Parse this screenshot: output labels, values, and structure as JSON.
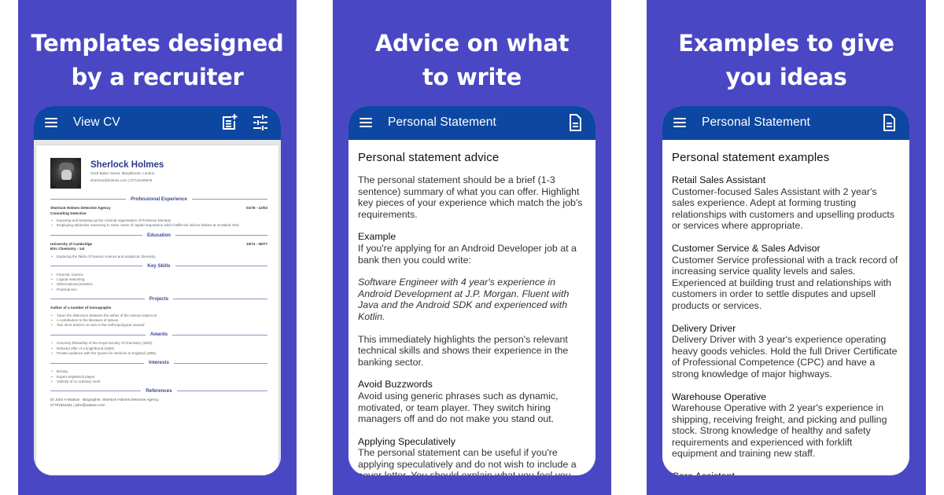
{
  "colors": {
    "panel_background": "#4a47c4",
    "app_bar": "#0d47a1",
    "heading_text": "#ffffff",
    "cv_name": "#283a8a"
  },
  "panels": [
    {
      "heading_line1": "Templates designed",
      "heading_line2": "by a recruiter",
      "app_bar": {
        "menu_icon": "hamburger-menu-icon",
        "title": "View CV",
        "actions": [
          "add-note-icon",
          "tune-settings-icon"
        ]
      },
      "cv": {
        "name": "Sherlock Holmes",
        "address": "221b Baker Street, Marylebone, London",
        "contact": "sherlock@holmes.com | 07712345678",
        "sections": {
          "experience": {
            "title": "Professional Experience",
            "employer": "Sherlock Holmes Detective Agency",
            "dates": "01/78 - 12/03",
            "role": "Consulting Detective",
            "bullets": [
              "Exposing and breaking up the criminal organisation of Professor Moriarty",
              "Employing abductive reasoning to solve cases of capital importance which baffle the inferior fellows at Scotland Yard"
            ]
          },
          "education": {
            "title": "Education",
            "institution": "University of Cambridge",
            "dates": "10/74 - 06/77",
            "degree": "BSc Chemistry - 1st",
            "bullets": [
              "Exploring the fields of forensic science and analytical chemistry"
            ]
          },
          "skills": {
            "title": "Key Skills",
            "bullets": [
              "Forensic science",
              "Logical reasoning",
              "Observational prowess",
              "Practical kno"
            ]
          },
          "projects": {
            "title": "Projects",
            "heading": "Author of a number of monographs",
            "bullets": [
              "'Upon the distinction between the ashes of the various tobaccos'",
              "A contribution to the literature of tattoos",
              "Two short articles on ears in the Anthropological Journal"
            ]
          },
          "awards": {
            "title": "Awards",
            "bullets": [
              "Honorary fellowship of the Royal Society of Chemistry (1902)",
              "Refused offer of a knighthood (1902)",
              "Private audience with the Queen for services to England (1895)"
            ]
          },
          "interests": {
            "title": "Interests",
            "bullets": [
              "Boxing",
              "Expert singlestick player",
              "Violinist of no ordinary merit"
            ]
          },
          "references": {
            "title": "References",
            "line1": "Dr John H Watson - Biographer, Sherlock Holmes Detective Agency",
            "line2": "07787654321 | john@watson.com"
          }
        }
      }
    },
    {
      "heading_line1": "Advice on what",
      "heading_line2": "to write",
      "app_bar": {
        "menu_icon": "hamburger-menu-icon",
        "title": "Personal Statement",
        "actions": [
          "document-icon"
        ]
      },
      "content": {
        "title": "Personal statement advice",
        "intro": "The personal statement should be a brief (1-3 sentence) summary of what you can offer. Highlight key pieces of your experience which match the job's requirements.",
        "example_title": "Example",
        "example_text": "If you're applying for an Android Developer job at a bank then you could write:",
        "example_quote": "Software Engineer with 4 year's experience in Android Development at J.P. Morgan. Fluent with Java and the Android SDK and experienced with Kotlin.",
        "example_followup": "This immediately highlights the person's relevant technical skills and shows their experience in the banking sector.",
        "buzzwords_title": "Avoid Buzzwords",
        "buzzwords_text": "Avoid using generic phrases such as dynamic, motivated, or team player. They switch hiring managers off and do not make you stand out.",
        "speculative_title": "Applying Speculatively",
        "speculative_text": "The personal statement can be useful if you're applying speculatively and do not wish to include a cover letter. You should explain what you feel you"
      }
    },
    {
      "heading_line1": "Examples to give",
      "heading_line2": "you ideas",
      "app_bar": {
        "menu_icon": "hamburger-menu-icon",
        "title": "Personal Statement",
        "actions": [
          "document-icon"
        ]
      },
      "content": {
        "title": "Personal statement examples",
        "examples": [
          {
            "role": "Retail Sales Assistant",
            "text": "Customer-focused Sales Assistant with 2 year's sales experience. Adept at forming trusting relationships with customers and upselling products or services where appropriate."
          },
          {
            "role": "Customer Service & Sales Advisor",
            "text": "Customer Service professional with a track record of increasing service quality levels and sales. Experienced at building trust and relationships with customers in order to settle disputes and upsell products or services."
          },
          {
            "role": "Delivery Driver",
            "text": "Delivery Driver with 3 year's experience operating heavy goods vehicles. Hold the full Driver Certificate of Professional Competence (CPC) and have a strong knowledge of major highways."
          },
          {
            "role": "Warehouse Operative",
            "text": "Warehouse Operative with 2 year's experience in shipping, receiving freight, and picking and pulling stock. Strong knowledge of healthy and safety requirements and experienced with forklift equipment and training new staff."
          },
          {
            "role": "Care Assistant",
            "text": ""
          }
        ]
      }
    }
  ]
}
